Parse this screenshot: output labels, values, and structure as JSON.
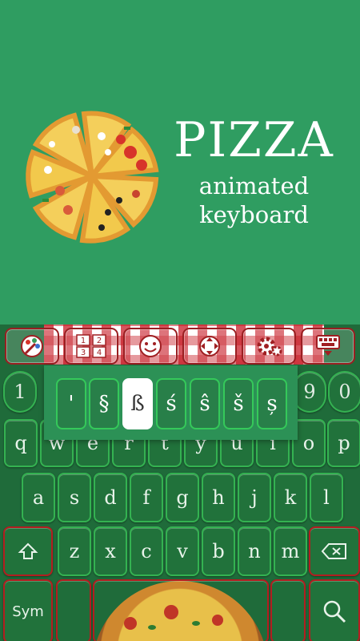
{
  "banner": {
    "title": "PIZZA",
    "subtitle_line1": "animated",
    "subtitle_line2": "keyboard"
  },
  "toolbar": {
    "items": [
      {
        "icon": "theme-palette-icon"
      },
      {
        "icon": "numpad-icon",
        "label": "1 2 3 4"
      },
      {
        "icon": "emoji-icon"
      },
      {
        "icon": "cursor-move-icon"
      },
      {
        "icon": "settings-gear-icon"
      },
      {
        "icon": "keyboard-hide-icon"
      }
    ]
  },
  "number_row": [
    "1",
    "9",
    "0"
  ],
  "row1": [
    "q",
    "w",
    "e",
    "r",
    "t",
    "y",
    "u",
    "i",
    "o",
    "p"
  ],
  "row2": [
    "a",
    "s",
    "d",
    "f",
    "g",
    "h",
    "j",
    "k",
    "l"
  ],
  "row3": [
    "z",
    "x",
    "c",
    "v",
    "b",
    "n",
    "m"
  ],
  "bottom": {
    "sym": "Sym"
  },
  "popup": {
    "chars": [
      "'",
      "§",
      "ß",
      "ś",
      "ŝ",
      "š",
      "ș"
    ],
    "selected_index": 2
  },
  "colors": {
    "banner_green": "#2f9d61",
    "key_border_green": "#35c95a",
    "key_border_red": "#b31d20"
  }
}
